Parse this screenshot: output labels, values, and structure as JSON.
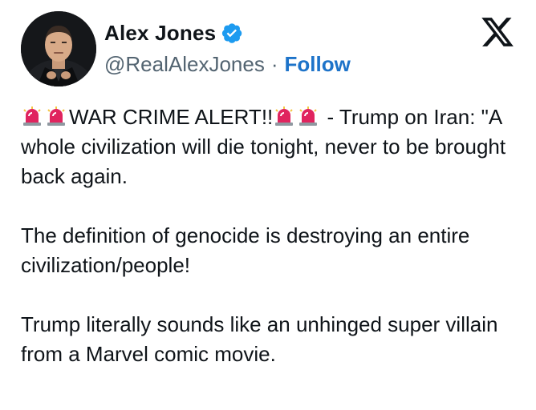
{
  "author": {
    "display_name": "Alex Jones",
    "handle": "@RealAlexJones",
    "separator": "·",
    "follow_label": "Follow",
    "verified": true,
    "verified_color": "#1d9bf0"
  },
  "platform": {
    "logo": "x-logo-icon"
  },
  "tweet": {
    "line1_prefix_icons": [
      "siren-icon",
      "siren-icon"
    ],
    "line1_text_a": "WAR CRIME ALERT!!",
    "line1_mid_icons": [
      "siren-icon",
      "siren-icon"
    ],
    "line1_text_b": " - Trump on Iran: \"A whole civilization will die tonight, never to be brought back again.",
    "paragraph2": "The definition of genocide is destroying an entire civilization/people!",
    "paragraph3": "Trump literally sounds like an unhinged super villain from a Marvel comic movie."
  },
  "colors": {
    "text": "#0f1419",
    "muted": "#536471",
    "link": "#1d73c9",
    "siren_red": "#e0245e"
  }
}
